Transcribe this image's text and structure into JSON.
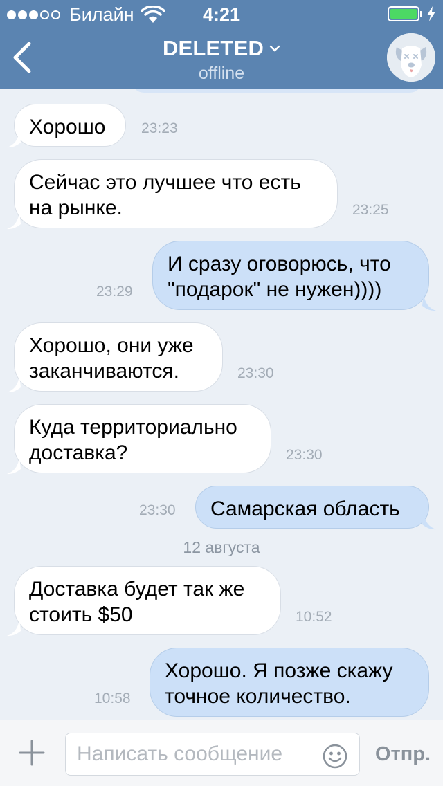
{
  "status_bar": {
    "carrier": "Билайн",
    "time": "4:21",
    "signal_icon": "signal-dots-icon",
    "wifi_icon": "wifi-icon",
    "battery_icon": "battery-charging-icon"
  },
  "header": {
    "title": "DELETED",
    "subtitle": "offline",
    "back_icon": "chevron-left-icon",
    "title_chevron_icon": "chevron-down-icon",
    "avatar_icon": "deleted-dog-avatar-icon"
  },
  "messages": [
    {
      "direction": "in",
      "lines": [
        "Хорошо"
      ],
      "time": "23:23"
    },
    {
      "direction": "in",
      "lines": [
        "Сейчас это лучшее что есть",
        "на рынке."
      ],
      "time": "23:25"
    },
    {
      "direction": "out",
      "lines": [
        "И сразу оговорюсь, что",
        "\"подарок\" не нужен))))"
      ],
      "time": "23:29"
    },
    {
      "direction": "in",
      "lines": [
        "Хорошо, они уже",
        "заканчиваются."
      ],
      "time": "23:30"
    },
    {
      "direction": "in",
      "lines": [
        "Куда территориально",
        "доставка?"
      ],
      "time": "23:30"
    },
    {
      "direction": "out",
      "lines": [
        "Самарская область"
      ],
      "time": "23:30"
    },
    {
      "direction": "in",
      "lines": [
        "Доставка будет так же",
        "стоить $50"
      ],
      "time": "10:52"
    },
    {
      "direction": "out",
      "lines": [
        "Хорошо. Я позже скажу",
        "точное количество."
      ],
      "time": "10:58"
    }
  ],
  "day_separator": "12 августа",
  "input_bar": {
    "placeholder": "Написать сообщение",
    "send_label": "Отпр.",
    "plus_icon": "plus-icon",
    "emoji_icon": "smiley-icon"
  },
  "colors": {
    "header_bg": "#5b84b1",
    "chat_bg": "#ebf0f6",
    "incoming_bubble": "#ffffff",
    "outgoing_bubble": "#cce0f8",
    "battery_green": "#4cd964"
  }
}
